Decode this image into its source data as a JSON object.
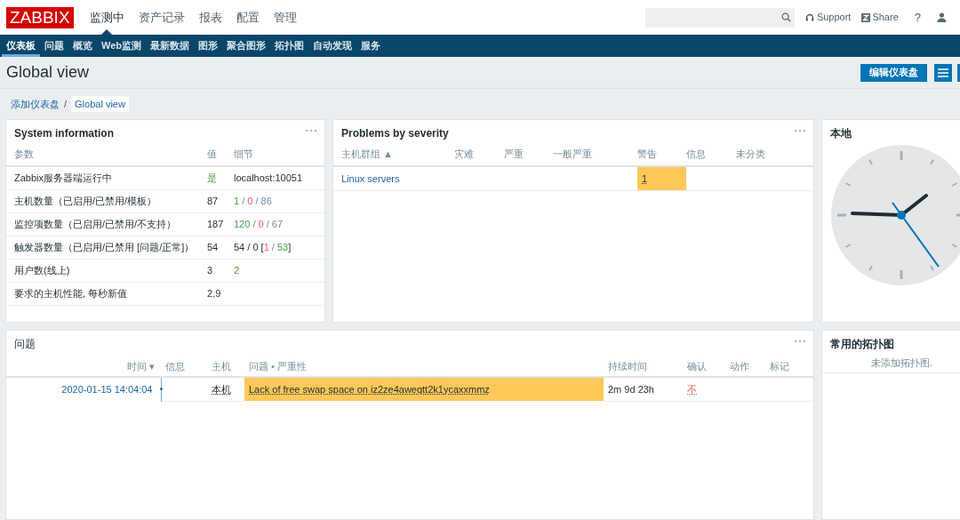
{
  "header": {
    "logo": "ZABBIX",
    "menu": [
      {
        "label": "监测中",
        "selected": true
      },
      {
        "label": "资产记录",
        "selected": false
      },
      {
        "label": "报表",
        "selected": false
      },
      {
        "label": "配置",
        "selected": false
      },
      {
        "label": "管理",
        "selected": false
      }
    ],
    "support": "Support",
    "share": "Share",
    "help": "?"
  },
  "subnav": [
    {
      "label": "仪表板",
      "selected": true
    },
    {
      "label": "问题",
      "selected": false
    },
    {
      "label": "概览",
      "selected": false
    },
    {
      "label": "Web监测",
      "selected": false
    },
    {
      "label": "最新数据",
      "selected": false
    },
    {
      "label": "图形",
      "selected": false
    },
    {
      "label": "聚合图形",
      "selected": false
    },
    {
      "label": "拓扑图",
      "selected": false
    },
    {
      "label": "自动发现",
      "selected": false
    },
    {
      "label": "服务",
      "selected": false
    }
  ],
  "page": {
    "title": "Global view",
    "edit_button": "编辑仪表盘",
    "breadcrumb": [
      "添加仪表盘",
      "Global view"
    ],
    "breadcrumb_separator": "/"
  },
  "system_information": {
    "title": "System information",
    "columns": [
      "参数",
      "值",
      "细节"
    ],
    "rows": [
      {
        "param": "Zabbix服务器端运行中",
        "value": [
          {
            "text": "是",
            "kind": "ok"
          }
        ],
        "details": [
          {
            "text": "localhost:10051",
            "kind": "plain"
          }
        ]
      },
      {
        "param": "主机数量（已启用/已禁用/模板）",
        "value": [
          {
            "text": "87",
            "kind": "plain"
          }
        ],
        "details": [
          {
            "text": "1",
            "kind": "ok"
          },
          {
            "text": " / ",
            "kind": "muted"
          },
          {
            "text": "0",
            "kind": "problem"
          },
          {
            "text": " / ",
            "kind": "muted"
          },
          {
            "text": "86",
            "kind": "muted"
          }
        ]
      },
      {
        "param": "监控项数量（已启用/已禁用/不支持）",
        "value": [
          {
            "text": "187",
            "kind": "plain"
          }
        ],
        "details": [
          {
            "text": "120",
            "kind": "ok"
          },
          {
            "text": " / ",
            "kind": "muted"
          },
          {
            "text": "0",
            "kind": "problem"
          },
          {
            "text": " / ",
            "kind": "muted"
          },
          {
            "text": "67",
            "kind": "muted"
          }
        ]
      },
      {
        "param": "触发器数量（已启用/已禁用 [问题/正常]）",
        "value": [
          {
            "text": "54",
            "kind": "plain"
          }
        ],
        "details": [
          {
            "text": "54 / 0 [",
            "kind": "plain"
          },
          {
            "text": "1",
            "kind": "problem"
          },
          {
            "text": " / ",
            "kind": "muted"
          },
          {
            "text": "53",
            "kind": "ok"
          },
          {
            "text": "]",
            "kind": "plain"
          }
        ]
      },
      {
        "param": "用户数(线上)",
        "value": [
          {
            "text": "3",
            "kind": "plain"
          }
        ],
        "details": [
          {
            "text": "2",
            "kind": "ok"
          }
        ]
      },
      {
        "param": "要求的主机性能, 每秒新值",
        "value": [
          {
            "text": "2.9",
            "kind": "plain"
          }
        ],
        "details": []
      }
    ]
  },
  "problems_by_severity": {
    "title": "Problems by severity",
    "columns": [
      "主机群组 ▲",
      "灾难",
      "严重",
      "一般严重",
      "警告",
      "信息",
      "未分类"
    ],
    "rows": [
      {
        "group": "Linux servers",
        "counts": [
          {
            "kind": "empty"
          },
          {
            "kind": "empty"
          },
          {
            "kind": "empty"
          },
          {
            "kind": "count",
            "text": "1",
            "color": "#ffc859"
          },
          {
            "kind": "empty"
          },
          {
            "kind": "empty"
          }
        ]
      }
    ]
  },
  "clock": {
    "title": "本地"
  },
  "problems": {
    "title": "问题",
    "columns": [
      "时间 ▾",
      "信息",
      "主机",
      "问题 • 严重性",
      "持续时间",
      "确认",
      "动作",
      "标记"
    ],
    "rows": [
      {
        "time": "2020-01-15 14:04:04",
        "host": "本机",
        "problem": "Lack of free swap space on iz2ze4aweqtt2k1ycaxxmmz",
        "color": "#ffc859",
        "duration": "2m 9d 23h",
        "ack": "不"
      }
    ]
  },
  "favourite_maps": {
    "title": "常用的拓扑图",
    "empty": "未添加拓扑图."
  }
}
